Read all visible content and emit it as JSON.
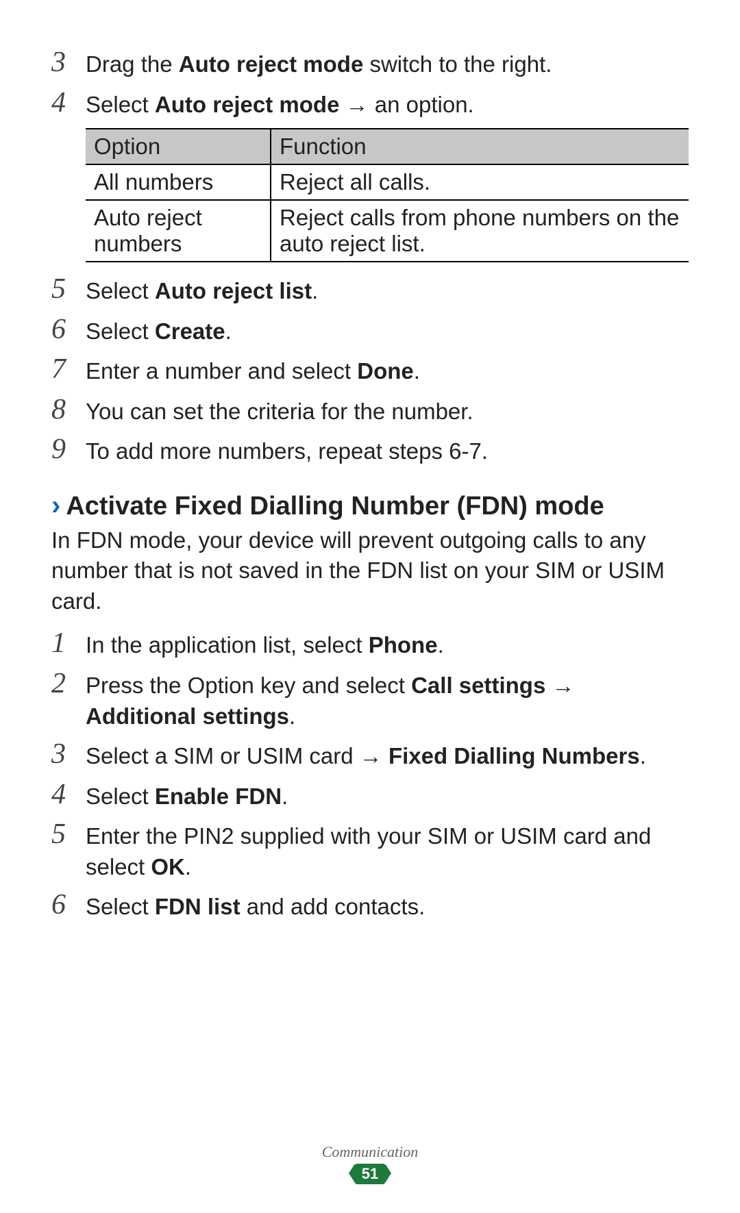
{
  "steps_a": [
    {
      "num": "3",
      "text": "Drag the ",
      "bold1": "Auto reject mode",
      "tail": " switch to the right."
    },
    {
      "num": "4",
      "text": "Select ",
      "bold1": "Auto reject mode",
      "tail": " → an option."
    }
  ],
  "table": {
    "headers": {
      "option": "Option",
      "function": "Function"
    },
    "rows": [
      {
        "option": "All numbers",
        "function": "Reject all calls."
      },
      {
        "option": "Auto reject numbers",
        "function": "Reject calls from phone numbers on the auto reject list."
      }
    ]
  },
  "steps_b": [
    {
      "num": "5",
      "text": "Select ",
      "bold1": "Auto reject list",
      "tail": "."
    },
    {
      "num": "6",
      "text": "Select ",
      "bold1": "Create",
      "tail": "."
    },
    {
      "num": "7",
      "text": "Enter a number and select ",
      "bold1": "Done",
      "tail": "."
    },
    {
      "num": "8",
      "text": "You can set the criteria for the number.",
      "bold1": "",
      "tail": ""
    },
    {
      "num": "9",
      "text": "To add more numbers, repeat steps 6-7.",
      "bold1": "",
      "tail": ""
    }
  ],
  "section": {
    "chevron": "›",
    "title": "Activate Fixed Dialling Number (FDN) mode",
    "desc": "In FDN mode, your device will prevent outgoing calls to any number that is not saved in the FDN list on your SIM or USIM card."
  },
  "steps_c": [
    {
      "num": "1",
      "pre": "In the application list, select ",
      "b1": "Phone",
      "mid": ".",
      "b2": "",
      "post": ""
    },
    {
      "num": "2",
      "pre": "Press the Option key and select ",
      "b1": "Call settings",
      "mid": " → ",
      "b2": "Additional settings",
      "post": "."
    },
    {
      "num": "3",
      "pre": "Select a SIM or USIM card → ",
      "b1": "Fixed Dialling Numbers",
      "mid": ".",
      "b2": "",
      "post": ""
    },
    {
      "num": "4",
      "pre": "Select ",
      "b1": "Enable FDN",
      "mid": ".",
      "b2": "",
      "post": ""
    },
    {
      "num": "5",
      "pre": "Enter the PIN2 supplied with your SIM or USIM card and select ",
      "b1": "OK",
      "mid": ".",
      "b2": "",
      "post": ""
    },
    {
      "num": "6",
      "pre": "Select ",
      "b1": "FDN list",
      "mid": " and add contacts.",
      "b2": "",
      "post": ""
    }
  ],
  "footer": {
    "label": "Communication",
    "page": "51"
  }
}
